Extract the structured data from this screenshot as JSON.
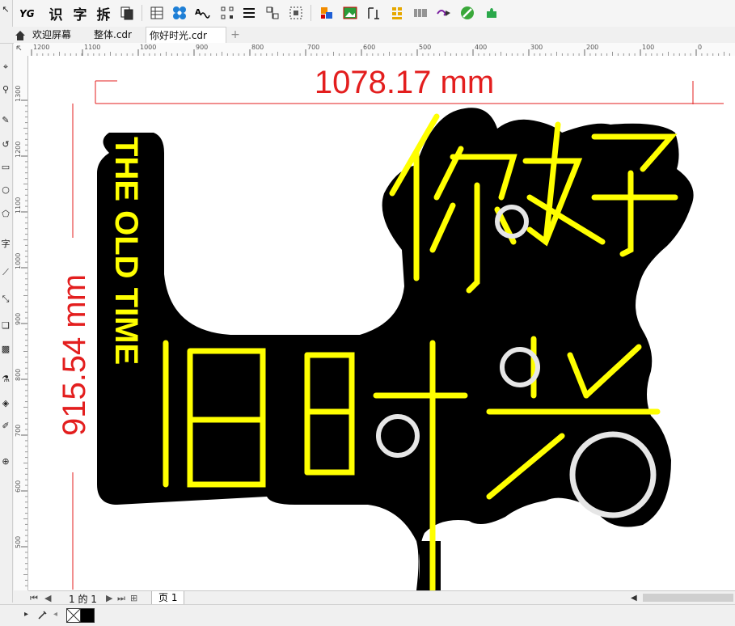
{
  "toolbar": {
    "text_tools": [
      "识",
      "字",
      "拆"
    ],
    "icons": [
      "pointer-icon",
      "yg-logo-icon",
      "copy-icon",
      "table-icon",
      "object-grid-icon",
      "wave-text-icon",
      "node-icon",
      "align-lines-icon",
      "distribute-icon",
      "select-frame-icon",
      "color-swatch-icon",
      "image-frame-icon",
      "text-align-icon",
      "color-bars-icon",
      "barcode-icon",
      "arrow-morph-icon",
      "green-knife-icon",
      "puzzle-icon"
    ]
  },
  "tabs": {
    "items": [
      {
        "label": "欢迎屏幕"
      },
      {
        "label": "整体.cdr"
      },
      {
        "label": "你好时光.cdr"
      }
    ],
    "add_label": "+"
  },
  "rulers": {
    "h_ticks": [
      "1200",
      "1100",
      "1000",
      "900",
      "800",
      "700",
      "600",
      "500",
      "400",
      "300",
      "200",
      "100",
      "0"
    ],
    "v_ticks": [
      "1300",
      "1200",
      "1100",
      "1000",
      "900",
      "800",
      "700",
      "600",
      "500"
    ]
  },
  "artwork": {
    "dimension_h": "1078.17 mm",
    "dimension_v": "915.54 mm",
    "vertical_text": "THE OLD TIME",
    "chars_top": "你好",
    "chars_bottom": "旧时光",
    "colors": {
      "neon_yellow": "#ffff00",
      "dimension_red": "#e31e1e",
      "board_black": "#000000",
      "circle_white": "#e6e6e6"
    }
  },
  "pagebar": {
    "page_count": "1 的 1",
    "page_tab": "页 1"
  }
}
